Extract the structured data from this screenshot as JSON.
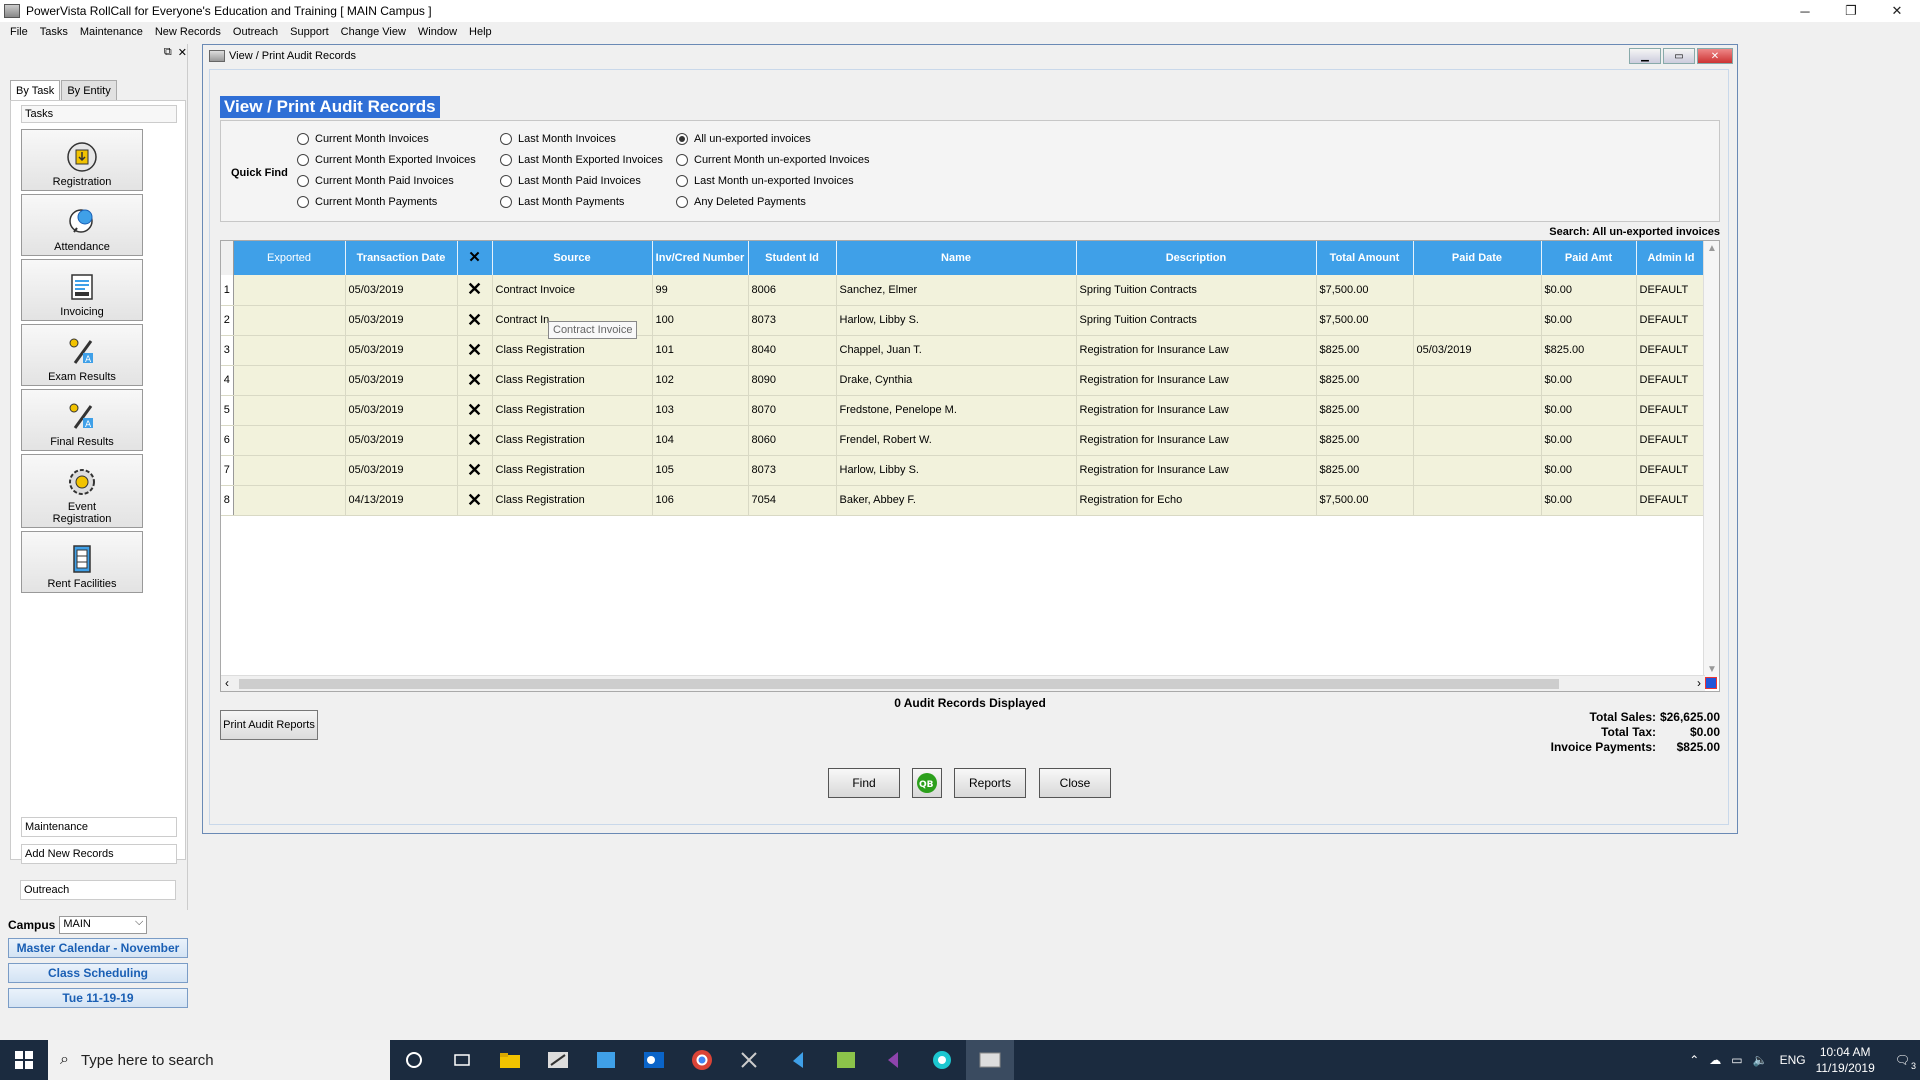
{
  "app": {
    "title": "PowerVista RollCall for Everyone's Education and Training   [ MAIN Campus ]",
    "controls": {
      "minimize": "─",
      "restore": "❐",
      "close": "✕"
    }
  },
  "menu": [
    "File",
    "Tasks",
    "Maintenance",
    "New Records",
    "Outreach",
    "Support",
    "Change View",
    "Window",
    "Help"
  ],
  "left_panel": {
    "tabs": [
      "By Task",
      "By Entity"
    ],
    "tasks_header": "Tasks",
    "tasks": [
      {
        "label": "Registration",
        "icon": "registration-icon"
      },
      {
        "label": "Attendance",
        "icon": "attendance-icon"
      },
      {
        "label": "Invoicing",
        "icon": "invoicing-icon"
      },
      {
        "label": "Exam Results",
        "icon": "exam-results-icon"
      },
      {
        "label": "Final Results",
        "icon": "final-results-icon"
      },
      {
        "label": "Event Registration",
        "icon": "event-registration-icon"
      },
      {
        "label": "Rent Facilities",
        "icon": "rent-facilities-icon"
      }
    ],
    "bottom_links": [
      "Maintenance",
      "Add New Records",
      "Outreach"
    ],
    "campus_label": "Campus",
    "campus_value": "MAIN",
    "nav_links": [
      "Master Calendar - November",
      "Class Scheduling",
      "Tue 11-19-19"
    ]
  },
  "window": {
    "title": "View / Print Audit Records",
    "page_title": "View / Print  Audit Records"
  },
  "quick_find": {
    "label": "Quick Find",
    "options": [
      [
        "Current Month Invoices",
        "Current Month Exported Invoices",
        "Current Month Paid Invoices",
        "Current Month Payments"
      ],
      [
        "Last Month Invoices",
        "Last Month Exported Invoices",
        "Last Month Paid Invoices",
        "Last Month Payments"
      ],
      [
        "All un-exported invoices",
        "Current Month un-exported Invoices",
        "Last Month un-exported Invoices",
        "Any Deleted Payments"
      ]
    ],
    "selected": "All un-exported invoices"
  },
  "search_line": "Search: All un-exported invoices",
  "table": {
    "columns": [
      "Exported",
      "Transaction Date",
      "✕",
      "Source",
      "Inv/Cred Number",
      "Student Id",
      "Name",
      "Description",
      "Total Amount",
      "Paid Date",
      "Paid Amt",
      "Admin Id"
    ],
    "rows": [
      [
        "1",
        "",
        "05/03/2019",
        "✕",
        "Contract Invoice",
        "99",
        "8006",
        "Sanchez, Elmer",
        "Spring Tuition Contracts",
        "$7,500.00",
        "",
        "$0.00",
        "DEFAULT"
      ],
      [
        "2",
        "",
        "05/03/2019",
        "✕",
        "Contract In",
        "100",
        "8073",
        "Harlow, Libby S.",
        "Spring Tuition Contracts",
        "$7,500.00",
        "",
        "$0.00",
        "DEFAULT"
      ],
      [
        "3",
        "",
        "05/03/2019",
        "✕",
        "Class Registration",
        "101",
        "8040",
        "Chappel, Juan T.",
        "Registration for Insurance Law",
        "$825.00",
        "05/03/2019",
        "$825.00",
        "DEFAULT"
      ],
      [
        "4",
        "",
        "05/03/2019",
        "✕",
        "Class Registration",
        "102",
        "8090",
        "Drake, Cynthia",
        "Registration for Insurance Law",
        "$825.00",
        "",
        "$0.00",
        "DEFAULT"
      ],
      [
        "5",
        "",
        "05/03/2019",
        "✕",
        "Class Registration",
        "103",
        "8070",
        "Fredstone, Penelope M.",
        "Registration for Insurance Law",
        "$825.00",
        "",
        "$0.00",
        "DEFAULT"
      ],
      [
        "6",
        "",
        "05/03/2019",
        "✕",
        "Class Registration",
        "104",
        "8060",
        "Frendel, Robert W.",
        "Registration for Insurance Law",
        "$825.00",
        "",
        "$0.00",
        "DEFAULT"
      ],
      [
        "7",
        "",
        "05/03/2019",
        "✕",
        "Class Registration",
        "105",
        "8073",
        "Harlow, Libby S.",
        "Registration for Insurance Law",
        "$825.00",
        "",
        "$0.00",
        "DEFAULT"
      ],
      [
        "8",
        "",
        "04/13/2019",
        "✕",
        "Class Registration",
        "106",
        "7054",
        "Baker, Abbey F.",
        "Registration for Echo",
        "$7,500.00",
        "",
        "$0.00",
        "DEFAULT"
      ]
    ],
    "tooltip": "Contract Invoice"
  },
  "records_count": "0 Audit Records Displayed",
  "print_button": "Print Audit Reports",
  "totals": {
    "sales_label": "Total Sales:",
    "sales_value": "$26,625.00",
    "tax_label": "Total Tax:",
    "tax_value": "$0.00",
    "payments_label": "Invoice Payments:",
    "payments_value": "$825.00"
  },
  "buttons": {
    "find": "Find",
    "qb": "QB",
    "reports": "Reports",
    "close": "Close"
  },
  "taskbar": {
    "search_placeholder": "Type here to search",
    "language": "ENG",
    "time": "10:04 AM",
    "date": "11/19/2019",
    "notifications": "3"
  }
}
